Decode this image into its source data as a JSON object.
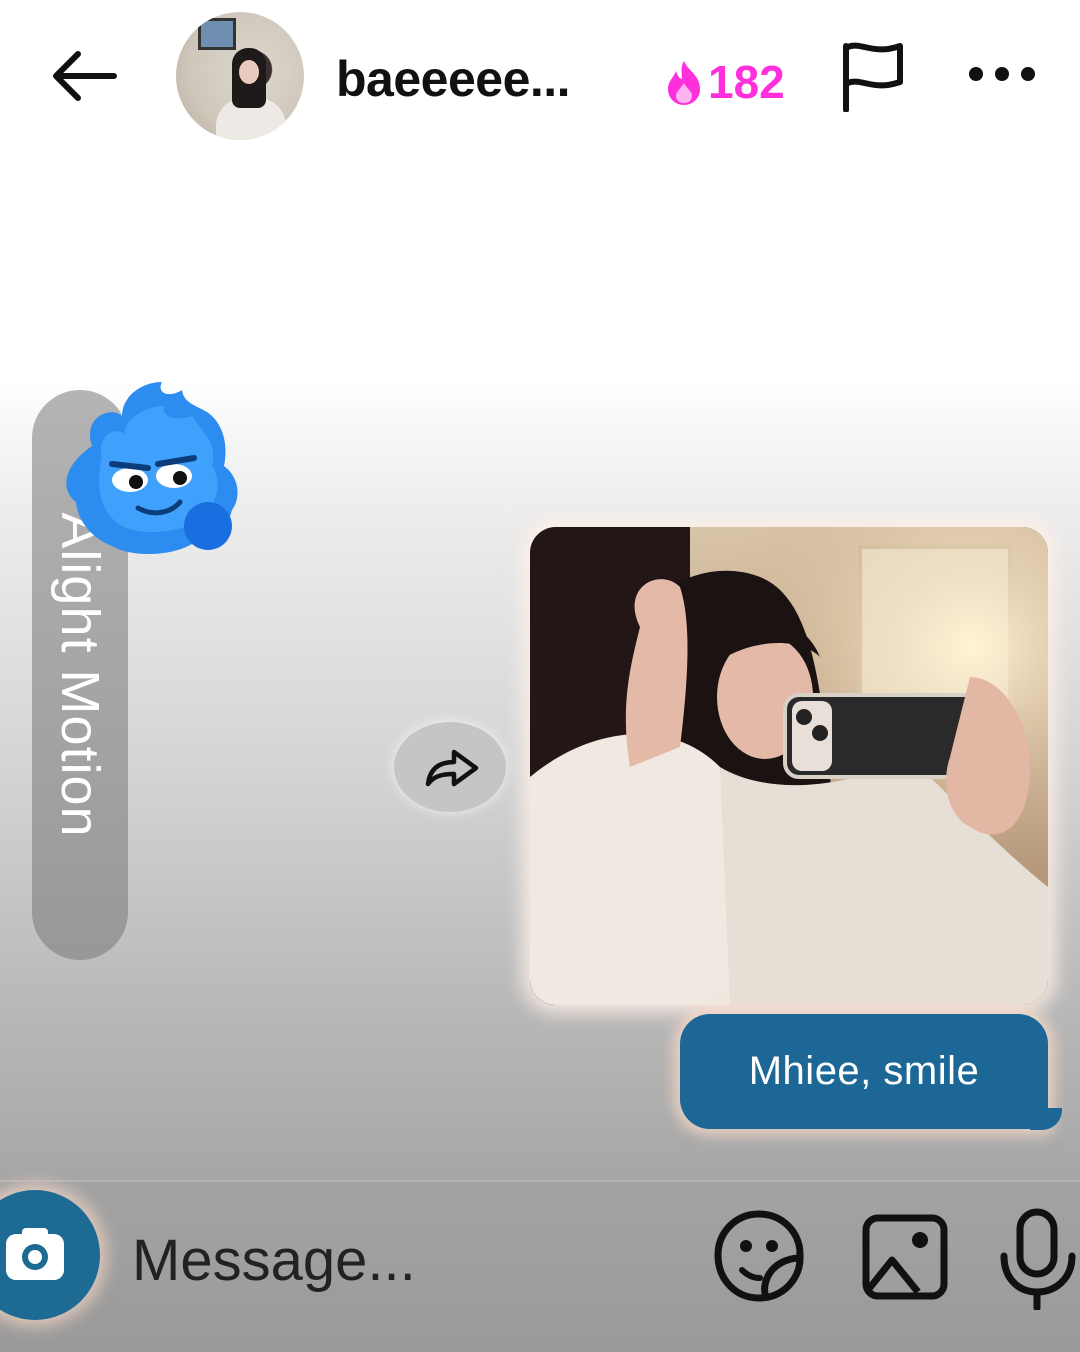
{
  "header": {
    "username": "baeeeee...",
    "streak_count": "182",
    "icons": {
      "back": "arrow-left-icon",
      "streak": "flame-icon",
      "report": "flag-icon",
      "more": "more-horizontal-icon"
    },
    "colors": {
      "streak": "#ff2fdc"
    }
  },
  "watermark": {
    "text": "Alight Motion"
  },
  "conversation": {
    "photo_message": {
      "description_icon": "photo-message"
    },
    "share_icon": "share-forward-icon",
    "text_message": "Mhiee, smile",
    "colors": {
      "sent_bubble": "#1c6796"
    }
  },
  "composer": {
    "placeholder": "Message...",
    "icons": {
      "camera": "camera-icon",
      "sticker": "sticker-icon",
      "gallery": "gallery-icon",
      "voice": "microphone-icon"
    },
    "colors": {
      "camera_button": "#1d6a93"
    }
  }
}
